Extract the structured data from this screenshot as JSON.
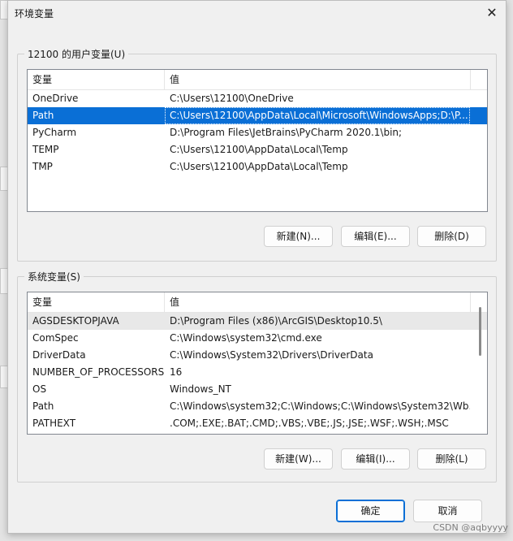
{
  "dialog": {
    "title": "环境变量",
    "close_glyph": "✕"
  },
  "user_vars": {
    "group_label": "12100 的用户变量(U)",
    "columns": [
      "变量",
      "值"
    ],
    "rows": [
      {
        "name": "OneDrive",
        "value": "C:\\Users\\12100\\OneDrive"
      },
      {
        "name": "Path",
        "value": "C:\\Users\\12100\\AppData\\Local\\Microsoft\\WindowsApps;D:\\P..."
      },
      {
        "name": "PyCharm",
        "value": "D:\\Program Files\\JetBrains\\PyCharm 2020.1\\bin;"
      },
      {
        "name": "TEMP",
        "value": "C:\\Users\\12100\\AppData\\Local\\Temp"
      },
      {
        "name": "TMP",
        "value": "C:\\Users\\12100\\AppData\\Local\\Temp"
      }
    ],
    "selected_index": 1,
    "buttons": {
      "new": "新建(N)...",
      "edit": "编辑(E)...",
      "delete": "删除(D)"
    }
  },
  "system_vars": {
    "group_label": "系统变量(S)",
    "columns": [
      "变量",
      "值"
    ],
    "rows": [
      {
        "name": "AGSDESKTOPJAVA",
        "value": "D:\\Program Files (x86)\\ArcGIS\\Desktop10.5\\"
      },
      {
        "name": "ComSpec",
        "value": "C:\\Windows\\system32\\cmd.exe"
      },
      {
        "name": "DriverData",
        "value": "C:\\Windows\\System32\\Drivers\\DriverData"
      },
      {
        "name": "NUMBER_OF_PROCESSORS",
        "value": "16"
      },
      {
        "name": "OS",
        "value": "Windows_NT"
      },
      {
        "name": "Path",
        "value": "C:\\Windows\\system32;C:\\Windows;C:\\Windows\\System32\\Wb..."
      },
      {
        "name": "PATHEXT",
        "value": ".COM;.EXE;.BAT;.CMD;.VBS;.VBE;.JS;.JSE;.WSF;.WSH;.MSC"
      }
    ],
    "hover_index": 0,
    "buttons": {
      "new": "新建(W)...",
      "edit": "编辑(I)...",
      "delete": "删除(L)"
    }
  },
  "footer": {
    "ok": "确定",
    "cancel": "取消"
  },
  "watermark": "CSDN @aqbyyyy"
}
